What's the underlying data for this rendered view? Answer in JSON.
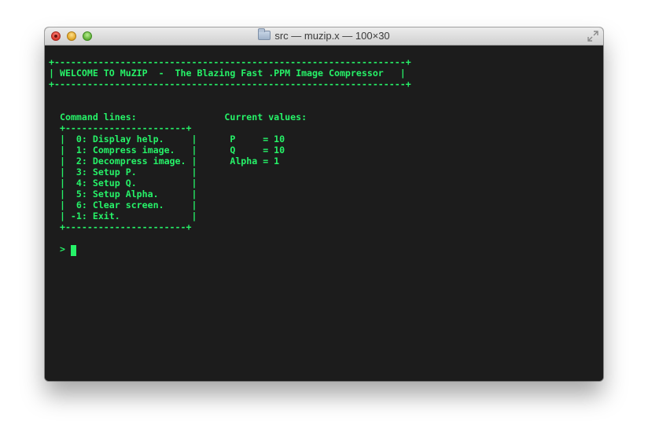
{
  "window": {
    "title": "src — muzip.x — 100×30"
  },
  "terminal": {
    "lines": [
      "+----------------------------------------------------------------+",
      "| WELCOME TO MuZIP  -  The Blazing Fast .PPM Image Compressor   |",
      "+----------------------------------------------------------------+",
      "",
      "",
      "  Command lines:                Current values:",
      "  +----------------------+",
      "  |  0: Display help.     |      P     = 10",
      "  |  1: Compress image.   |      Q     = 10",
      "  |  2: Decompress image. |      Alpha = 1",
      "  |  3: Setup P.          |",
      "  |  4: Setup Q.          |",
      "  |  5: Setup Alpha.      |",
      "  |  6: Clear screen.     |",
      "  | -1: Exit.             |",
      "  +----------------------+",
      "",
      "  > "
    ],
    "text_color": "#26f268",
    "background_color": "#1c1c1c"
  },
  "icons": {
    "folder": "folder-icon",
    "fullscreen": "fullscreen-icon"
  }
}
